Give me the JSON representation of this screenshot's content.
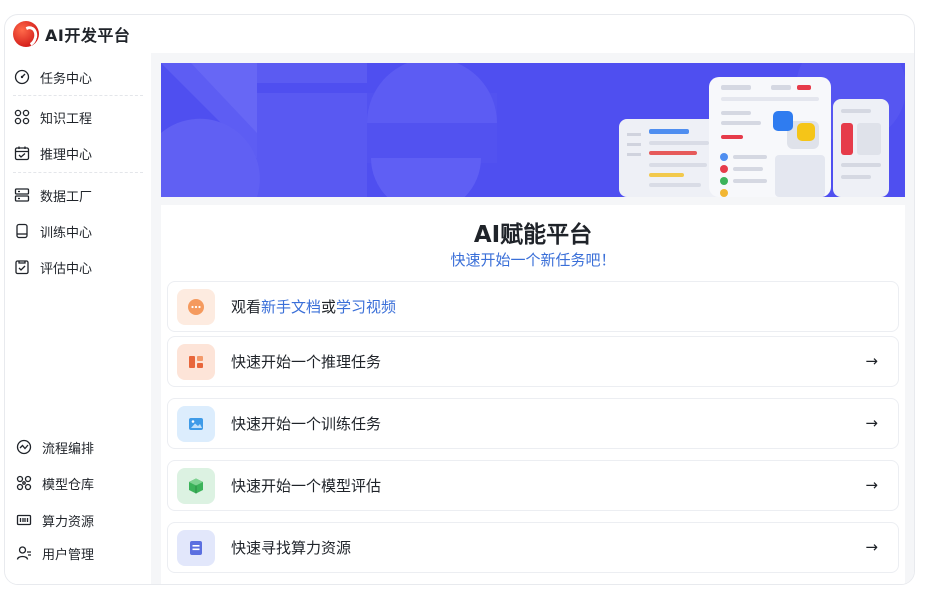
{
  "app": {
    "logo_text": "AI开发平台",
    "brand_color": "#d5201c"
  },
  "sidebar": {
    "top_items": [
      {
        "label": "任务中心",
        "icon": "dashboard-icon"
      },
      {
        "label": "知识工程",
        "icon": "grid-circles-icon"
      },
      {
        "label": "推理中心",
        "icon": "calendar-check-icon"
      },
      {
        "label": "数据工厂",
        "icon": "server-icon"
      },
      {
        "label": "训练中心",
        "icon": "tablet-icon"
      },
      {
        "label": "评估中心",
        "icon": "clipboard-check-icon"
      }
    ],
    "bottom_items": [
      {
        "label": "流程编排",
        "icon": "flow-icon"
      },
      {
        "label": "模型仓库",
        "icon": "network-icon"
      },
      {
        "label": "算力资源",
        "icon": "chip-icon"
      },
      {
        "label": "用户管理",
        "icon": "user-icon"
      }
    ]
  },
  "main": {
    "title": "AI赋能平台",
    "subtitle": "快速开始一个新任务吧！",
    "docs_card": {
      "prefix": "观看",
      "link1": "新手文档",
      "mid": "或",
      "link2": "学习视频",
      "icon": "chat-icon"
    },
    "cards": [
      {
        "label": "快速开始一个推理任务",
        "icon": "inference-icon",
        "color": "#e8663b",
        "bg": "#fdebe2"
      },
      {
        "label": "快速开始一个训练任务",
        "icon": "image-icon",
        "color": "#3e9be8",
        "bg": "#e3f1fd"
      },
      {
        "label": "快速开始一个模型评估",
        "icon": "cube-icon",
        "color": "#3cb35a",
        "bg": "#e2f5e7"
      },
      {
        "label": "快速寻找算力资源",
        "icon": "document-icon",
        "color": "#5b6fe0",
        "bg": "#e6eafc"
      }
    ],
    "arrow": "→",
    "accent_color": "#4f4ff0",
    "link_color": "#3a6fd8"
  }
}
